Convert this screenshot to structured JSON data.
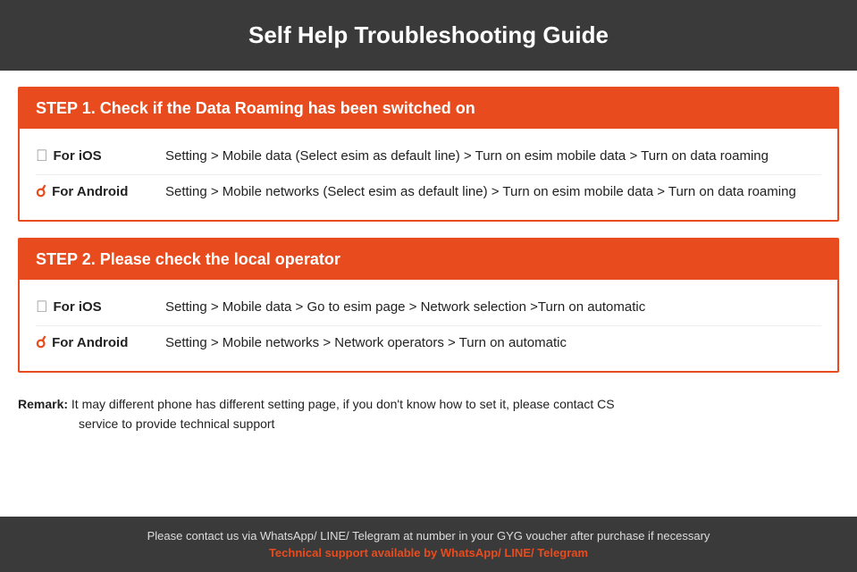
{
  "header": {
    "title": "Self Help Troubleshooting Guide"
  },
  "step1": {
    "header": "STEP 1.  Check if the Data Roaming has been switched on",
    "rows": [
      {
        "platform": "For iOS",
        "icon_type": "ios",
        "description": "Setting > Mobile data (Select esim as default line) > Turn on esim mobile data > Turn on data roaming"
      },
      {
        "platform": "For Android",
        "icon_type": "android",
        "description": "Setting > Mobile networks (Select esim as default line) > Turn on esim mobile data > Turn on data roaming"
      }
    ]
  },
  "step2": {
    "header": "STEP 2.  Please check the local operator",
    "rows": [
      {
        "platform": "For iOS",
        "icon_type": "ios",
        "description": "Setting > Mobile data > Go to esim page > Network selection >Turn on automatic"
      },
      {
        "platform": "For Android",
        "icon_type": "android",
        "description": "Setting > Mobile networks > Network operators > Turn on automatic"
      }
    ]
  },
  "remark": {
    "label": "Remark:",
    "text": "It may different phone has different setting page, if you don't know how to set it,  please contact CS service to provide technical support"
  },
  "footer": {
    "main": "Please contact us via WhatsApp/ LINE/ Telegram at number in your GYG voucher after purchase if necessary",
    "support": "Technical support available by WhatsApp/ LINE/ Telegram"
  }
}
